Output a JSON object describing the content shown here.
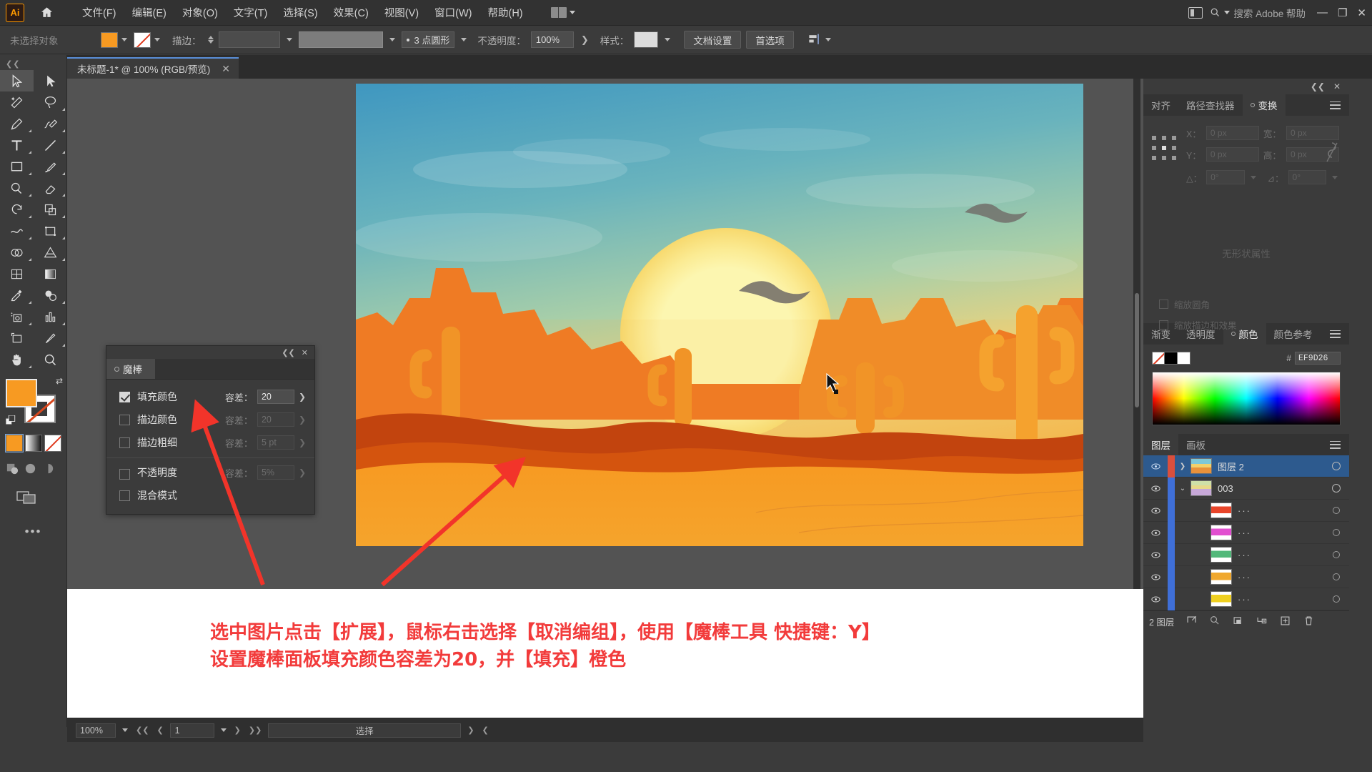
{
  "app": {
    "logo": "Ai",
    "menus": [
      "文件(F)",
      "编辑(E)",
      "对象(O)",
      "文字(T)",
      "选择(S)",
      "效果(C)",
      "视图(V)",
      "窗口(W)",
      "帮助(H)"
    ],
    "search_placeholder": "搜索 Adobe 帮助",
    "window_buttons": [
      "—",
      "❐",
      "✕"
    ]
  },
  "control_bar": {
    "selection_status": "未选择对象",
    "fill_color": "#F79A22",
    "stroke_label": "描边：",
    "stroke_weight": "",
    "brush_profile": "3 点圆形",
    "opacity_label": "不透明度：",
    "opacity_value": "100%",
    "style_label": "样式：",
    "document_setup": "文档设置",
    "preferences": "首选项"
  },
  "document_tab": {
    "title": "未标题-1* @ 100% (RGB/预览)",
    "close": "✕"
  },
  "toolbar": {
    "tools": [
      "selection-tool",
      "direct-selection-tool",
      "magic-wand-tool",
      "lasso-tool",
      "pen-tool",
      "curvature-tool",
      "type-tool",
      "line-segment-tool",
      "rectangle-tool",
      "paintbrush-tool",
      "shaper-tool",
      "eraser-tool",
      "rotate-tool",
      "scale-tool",
      "width-tool",
      "free-transform-tool",
      "shape-builder-tool",
      "perspective-grid-tool",
      "mesh-tool",
      "gradient-tool",
      "eyedropper-tool",
      "blend-tool",
      "symbol-sprayer-tool",
      "column-graph-tool",
      "artboard-tool",
      "slice-tool",
      "hand-tool",
      "zoom-tool"
    ],
    "fill_color": "#F79A22",
    "stroke_color": "#FFFFFF",
    "more_tools": "•••"
  },
  "magic_wand_panel": {
    "title": "魔棒",
    "collapse": "❮❮",
    "close": "✕",
    "tolerance_label": "容差：",
    "options": [
      {
        "label": "填充颜色",
        "checked": true,
        "tolerance": "20",
        "enabled": true
      },
      {
        "label": "描边颜色",
        "checked": false,
        "tolerance": "20",
        "enabled": false
      },
      {
        "label": "描边粗细",
        "checked": false,
        "tolerance": "5 pt",
        "enabled": false
      },
      {
        "label": "不透明度",
        "checked": false,
        "tolerance": "5%",
        "enabled": false
      },
      {
        "label": "混合模式",
        "checked": false,
        "tolerance": "",
        "enabled": false
      }
    ]
  },
  "transform_panel": {
    "tabs": [
      {
        "label": "对齐",
        "active": false
      },
      {
        "label": "路径查找器",
        "active": false
      },
      {
        "label": "变换",
        "active": true
      }
    ],
    "fields": [
      {
        "label": "X：",
        "value": "0 px"
      },
      {
        "label": "宽：",
        "value": "0 px"
      },
      {
        "label": "Y：",
        "value": "0 px"
      },
      {
        "label": "高：",
        "value": "0 px"
      }
    ],
    "angle_label": "△：",
    "angle_value": "0°",
    "shear_label": "⊿：",
    "shear_value": "0°",
    "empty_text": "无形状属性",
    "checkbox_1": "缩放圆角",
    "checkbox_2": "缩放描边和效果",
    "collapse": "❮❮",
    "close": "✕"
  },
  "color_panel": {
    "tabs": [
      {
        "label": "渐变",
        "active": false
      },
      {
        "label": "透明度",
        "active": false
      },
      {
        "label": "颜色",
        "active": true
      },
      {
        "label": "颜色参考",
        "active": false
      }
    ],
    "hash": "#",
    "hex_value": "EF9D26"
  },
  "layers_panel": {
    "tabs": [
      {
        "label": "图层",
        "active": true
      },
      {
        "label": "画板",
        "active": false
      }
    ],
    "rows": [
      {
        "name": "图层 2",
        "selected": true,
        "indent": 0,
        "expand": "❯",
        "thumb": "#e8913a",
        "color": "#d94f3d"
      },
      {
        "name": "003",
        "selected": false,
        "indent": 0,
        "expand": "⌄",
        "thumb": "#cfd8c0",
        "color": "#3f6fd8"
      },
      {
        "name": "···",
        "selected": false,
        "indent": 1,
        "expand": "",
        "thumb": "#e8452a",
        "color": "#3f6fd8"
      },
      {
        "name": "···",
        "selected": false,
        "indent": 1,
        "expand": "",
        "thumb": "#e24fd0",
        "color": "#3f6fd8"
      },
      {
        "name": "···",
        "selected": false,
        "indent": 1,
        "expand": "",
        "thumb": "#52b87a",
        "color": "#3f6fd8"
      },
      {
        "name": "···",
        "selected": false,
        "indent": 1,
        "expand": "",
        "thumb": "#f0a82e",
        "color": "#3f6fd8"
      },
      {
        "name": "···",
        "selected": false,
        "indent": 1,
        "expand": "",
        "thumb": "#f0d020",
        "color": "#3f6fd8"
      }
    ],
    "footer_count": "2 图层",
    "footer_icons": [
      "locate-object-icon",
      "search-icon",
      "make-clipping-mask-icon",
      "create-sublayer-icon",
      "create-new-layer-icon",
      "delete-layer-icon"
    ]
  },
  "annotation": {
    "line1": "选中图片点击【扩展】，鼠标右击选择【取消编组】，使用【魔棒工具 快捷键：Y】",
    "line2": "设置魔棒面板填充颜色容差为20，并【填充】橙色",
    "color": "#F23B3B"
  },
  "status_bar": {
    "zoom": "100%",
    "page": "1",
    "status": "选择"
  },
  "artwork": {
    "description": "desert-sunset-illustration",
    "sky_top": "#4a9fc4",
    "sky_mid": "#8fc6c4",
    "sun": "#fdf3a8",
    "dune_light": "#f7a02a",
    "dune_dark": "#c2440e",
    "foreground": "#f79a22"
  }
}
